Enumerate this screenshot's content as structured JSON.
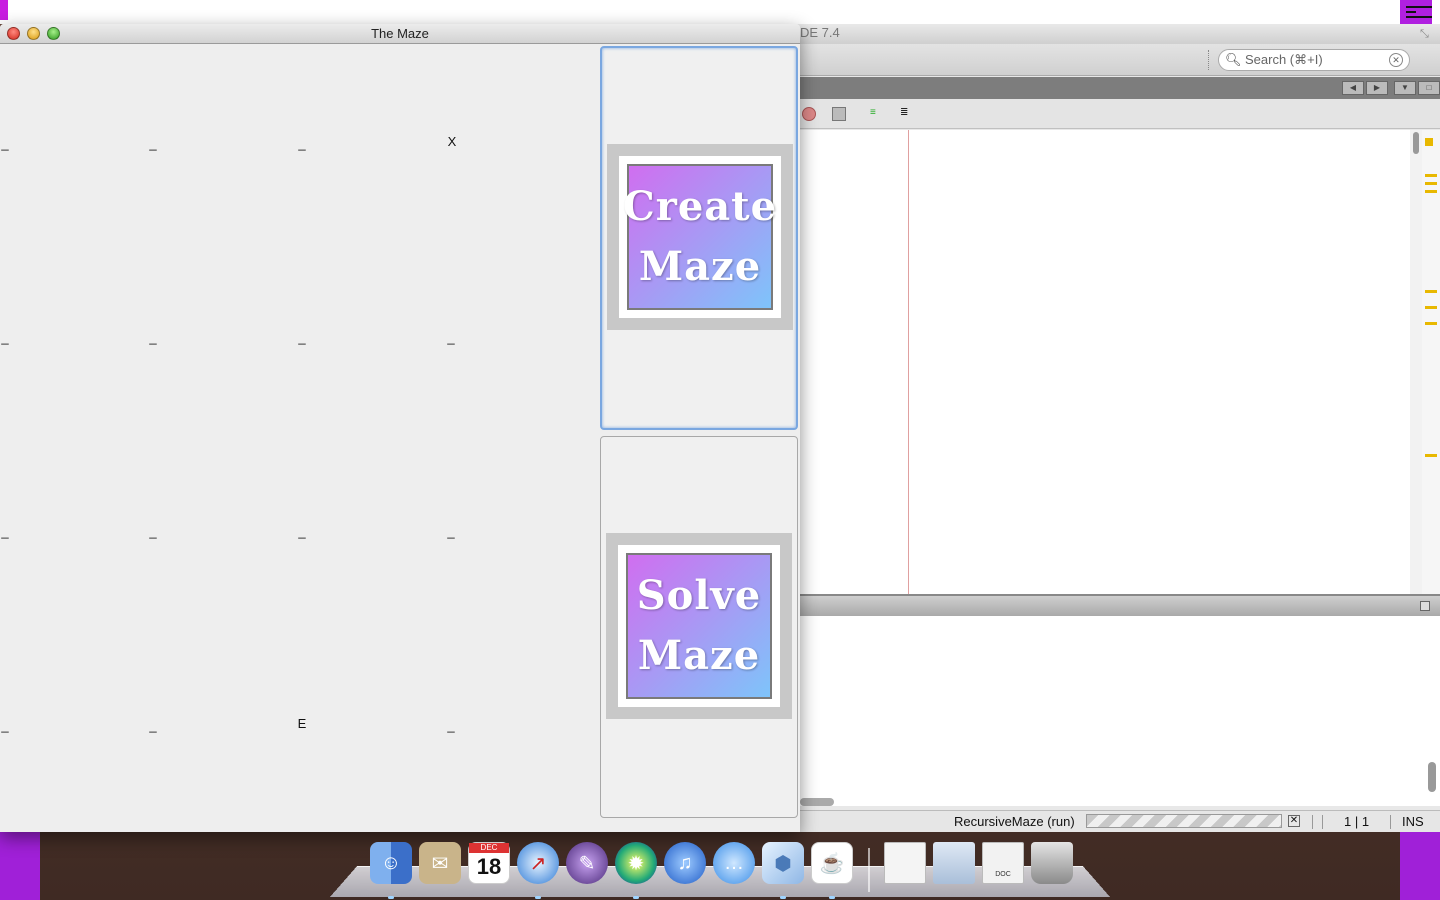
{
  "menubar": {
    "icon": "menu-lines-icon"
  },
  "ide": {
    "title_fragment": "DE 7.4",
    "search_placeholder": "Search (⌘+I)",
    "status": {
      "run_label": "RecursiveMaze (run)",
      "position": "1 | 1",
      "mode": "INS"
    }
  },
  "maze_window": {
    "title": "The Maze",
    "grid": {
      "rows": [
        [
          "_",
          "_",
          "_",
          "X"
        ],
        [
          "_",
          "_",
          "_",
          "_"
        ],
        [
          "_",
          "_",
          "_",
          "_"
        ],
        [
          "_",
          "_",
          "E",
          "_"
        ]
      ]
    },
    "buttons": {
      "create": {
        "line1": "Create",
        "line2": "Maze"
      },
      "solve": {
        "line1": "Solve",
        "line2": "Maze"
      }
    }
  },
  "dock": {
    "items": [
      "finder-icon",
      "mail-icon",
      "calendar-icon",
      "safari-icon",
      "quill-icon",
      "game-icon",
      "itunes-icon",
      "messages-icon",
      "cube-icon",
      "java-icon",
      "document-icon",
      "files-icon",
      "doc-file-icon",
      "trash-icon"
    ],
    "calendar_month": "DEC",
    "calendar_day": "18",
    "doc_label": "DOC"
  },
  "colors": {
    "accent_purple": "#a020d8",
    "button_gradient_start": "#d06ef0",
    "button_gradient_end": "#7ec4fa",
    "focus_ring": "#7aa7e0"
  }
}
